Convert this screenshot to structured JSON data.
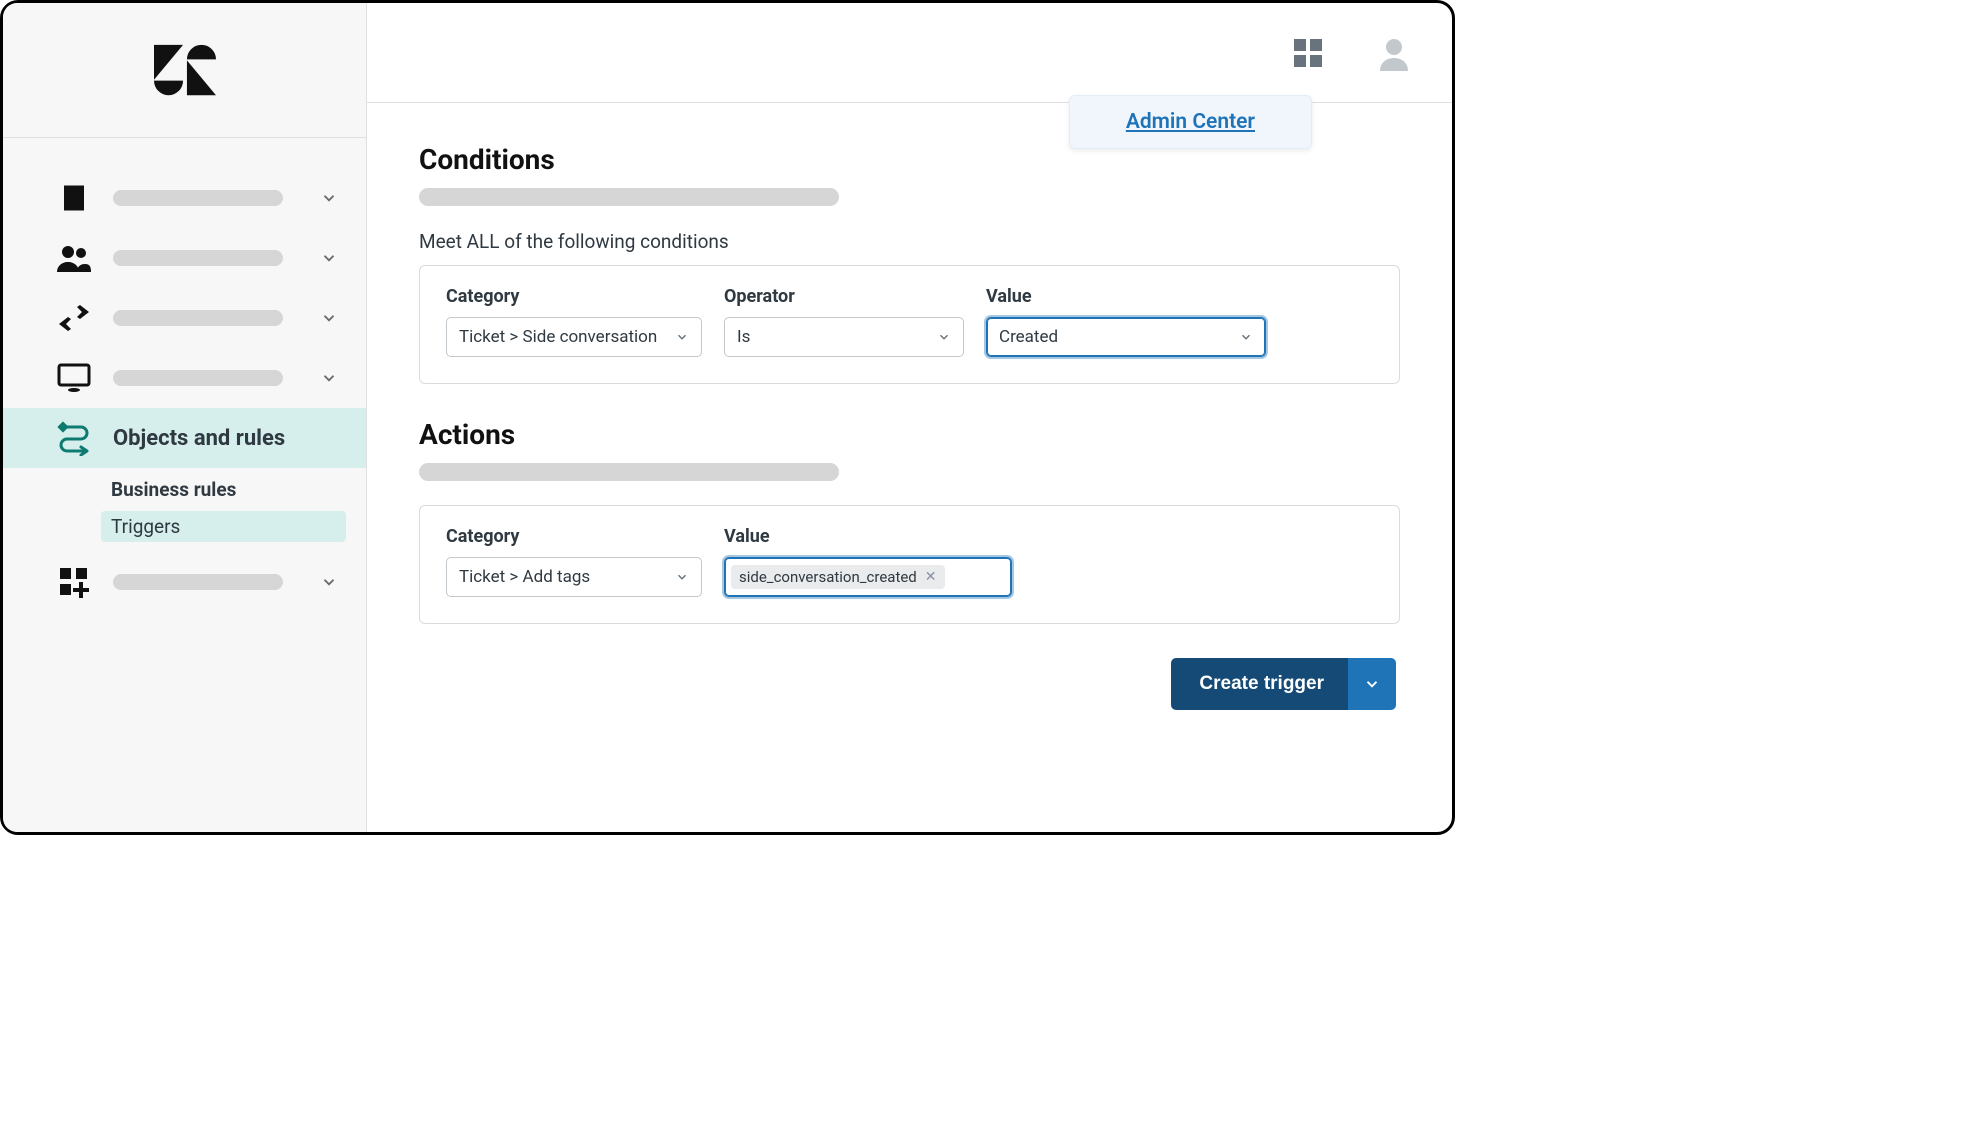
{
  "topbar": {
    "admin_center_label": "Admin Center"
  },
  "sidebar": {
    "active_label": "Objects and rules",
    "sub_heading": "Business rules",
    "sub_item": "Triggers"
  },
  "conditions": {
    "title": "Conditions",
    "meet_all_label": "Meet ALL of the following conditions",
    "headers": {
      "category": "Category",
      "operator": "Operator",
      "value": "Value"
    },
    "row": {
      "category": "Ticket > Side conversation",
      "operator": "Is",
      "value": "Created"
    }
  },
  "actions": {
    "title": "Actions",
    "headers": {
      "category": "Category",
      "value": "Value"
    },
    "row": {
      "category": "Ticket > Add tags",
      "tag": "side_conversation_created"
    }
  },
  "footer": {
    "create_trigger": "Create trigger"
  }
}
